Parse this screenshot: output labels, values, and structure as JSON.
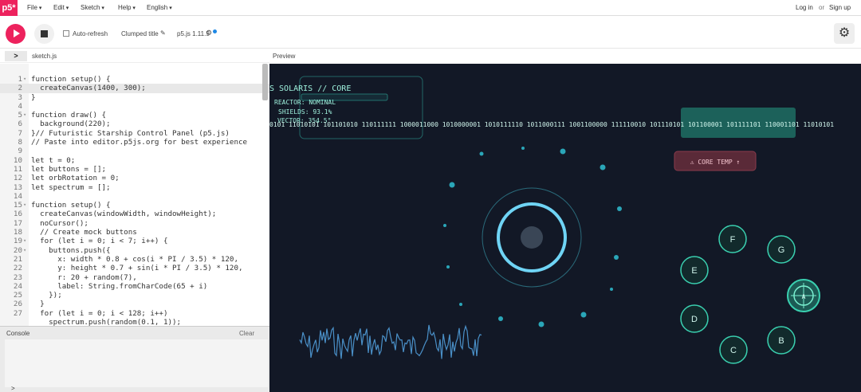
{
  "nav": {
    "logo": "p5*",
    "menus": [
      "File",
      "Edit",
      "Sketch",
      "Help",
      "English"
    ],
    "login": "Log in",
    "or": "or",
    "signup": "Sign up"
  },
  "toolbar": {
    "auto_refresh": "Auto-refresh",
    "sketch_title": "Clumped title",
    "version": "p5.js 1.11.5",
    "settings_icon": "gear-icon"
  },
  "editor": {
    "file_name": "sketch.js",
    "preview_label": "Preview",
    "lines": [
      {
        "n": "1",
        "fold": true,
        "t": "function setup() {"
      },
      {
        "n": "2",
        "fold": false,
        "t": "  createCanvas(1400, 300);",
        "hl": true
      },
      {
        "n": "3",
        "fold": false,
        "t": "}"
      },
      {
        "n": "4",
        "fold": false,
        "t": ""
      },
      {
        "n": "5",
        "fold": true,
        "t": "function draw() {"
      },
      {
        "n": "6",
        "fold": false,
        "t": "  background(220);"
      },
      {
        "n": "7",
        "fold": false,
        "t": "}// Futuristic Starship Control Panel (p5.js)"
      },
      {
        "n": "8",
        "fold": false,
        "t": "// Paste into editor.p5js.org for best experience"
      },
      {
        "n": "9",
        "fold": false,
        "t": ""
      },
      {
        "n": "10",
        "fold": false,
        "t": "let t = 0;"
      },
      {
        "n": "11",
        "fold": false,
        "t": "let buttons = [];"
      },
      {
        "n": "12",
        "fold": false,
        "t": "let orbRotation = 0;"
      },
      {
        "n": "13",
        "fold": false,
        "t": "let spectrum = [];"
      },
      {
        "n": "14",
        "fold": false,
        "t": ""
      },
      {
        "n": "15",
        "fold": true,
        "t": "function setup() {"
      },
      {
        "n": "16",
        "fold": false,
        "t": "  createCanvas(windowWidth, windowHeight);"
      },
      {
        "n": "17",
        "fold": false,
        "t": "  noCursor();"
      },
      {
        "n": "18",
        "fold": false,
        "t": "  // Create mock buttons"
      },
      {
        "n": "19",
        "fold": true,
        "t": "  for (let i = 0; i < 7; i++) {"
      },
      {
        "n": "20",
        "fold": true,
        "t": "    buttons.push({"
      },
      {
        "n": "21",
        "fold": false,
        "t": "      x: width * 0.8 + cos(i * PI / 3.5) * 120,"
      },
      {
        "n": "22",
        "fold": false,
        "t": "      y: height * 0.7 + sin(i * PI / 3.5) * 120,"
      },
      {
        "n": "23",
        "fold": false,
        "t": "      r: 20 + random(7),"
      },
      {
        "n": "24",
        "fold": false,
        "t": "      label: String.fromCharCode(65 + i)"
      },
      {
        "n": "25",
        "fold": false,
        "t": "    });"
      },
      {
        "n": "26",
        "fold": false,
        "t": "  }"
      },
      {
        "n": "27",
        "fold": false,
        "t": "  for (let i = 0; i < 128; i++)"
      },
      {
        "n": "",
        "fold": false,
        "t": "    spectrum.push(random(0.1, 1));"
      }
    ]
  },
  "console": {
    "title": "Console",
    "clear": "Clear",
    "prompt": ">"
  },
  "preview": {
    "core_title": "S SOLARIS // CORE",
    "reactor": "REACTOR:  NOMINAL",
    "shields": "SHIELDS:  93.1%",
    "vector": "VECTOR:   354.5°",
    "binary": "0101 11010101 101101010 110111111 1000011000 1010000001 1010111110 1011000111 1001100000 111110010 101110101 101100001 101111101 110001101 11010101",
    "alert": "⚠ CORE TEMP ↑",
    "buttons": [
      "A",
      "B",
      "C",
      "D",
      "E",
      "F",
      "G"
    ],
    "colors": {
      "bg": "#121826",
      "accent": "#4fc3e8",
      "teal": "#2fa89a",
      "alert": "#8a3b4c"
    }
  }
}
